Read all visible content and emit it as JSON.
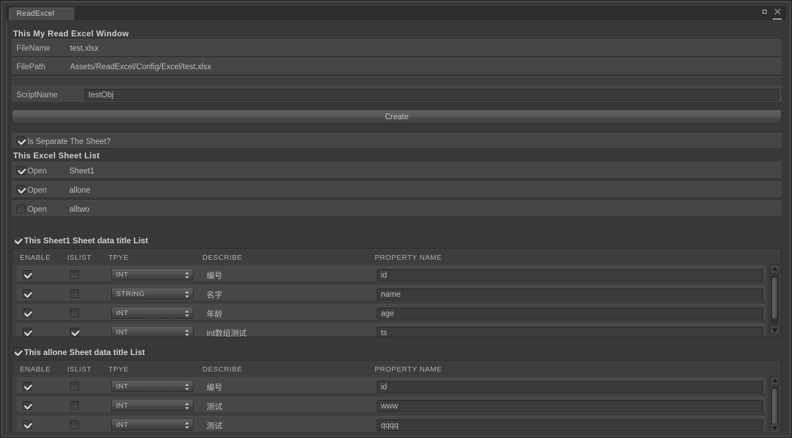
{
  "window": {
    "tab_label": "ReadExcel",
    "header_title": "This My  Read Excel Window",
    "maximize_icon": "maximize-icon",
    "close_icon": "close-icon",
    "menu_icon": "hamburger-menu-icon",
    "menu_arrow_icon": "chevron-down-icon"
  },
  "fields": {
    "filename_label": "FileName",
    "filename_value": "test.xlsx",
    "filepath_label": "FilePath",
    "filepath_value": "Assets/ReadExcel/Config/Excel/test.xlsx",
    "scriptname_label": "ScriptName",
    "scriptname_value": "testObj",
    "scriptname_placeholder": "testObj"
  },
  "create_button": {
    "label": "Create"
  },
  "separate": {
    "label": "Is Separate The Sheet?",
    "checked": true
  },
  "sheet_list": {
    "title": "This  Excel Sheet List",
    "items": [
      {
        "toggle_label": "Open",
        "name": "Sheet1",
        "checked": true
      },
      {
        "toggle_label": "Open",
        "name": "allone",
        "checked": true
      },
      {
        "toggle_label": "Open",
        "name": "alltwo",
        "checked": false
      }
    ]
  },
  "tables": [
    {
      "title": "This Sheet1 Sheet data title List",
      "checked": true,
      "columns": [
        "ENABLE",
        "ISLIST",
        "TPYE",
        "DESCRIBE",
        "PROPERTY NAME"
      ],
      "rows": [
        {
          "enable": true,
          "islist": false,
          "type": "INT",
          "describe": "编号",
          "property": "id"
        },
        {
          "enable": true,
          "islist": false,
          "type": "STRING",
          "describe": "名字",
          "property": "name"
        },
        {
          "enable": true,
          "islist": false,
          "type": "INT",
          "describe": "年龄",
          "property": "age"
        },
        {
          "enable": true,
          "islist": true,
          "type": "INT",
          "describe": "int数组测试",
          "property": "ts"
        }
      ],
      "scrollbar": {
        "up_arrow_icon": "triangle-up-icon",
        "down_arrow_icon": "triangle-down-icon"
      }
    },
    {
      "title": "This allone Sheet data title List",
      "checked": true,
      "columns": [
        "ENABLE",
        "ISLIST",
        "TPYE",
        "DESCRIBE",
        "PROPERTY NAME"
      ],
      "rows": [
        {
          "enable": true,
          "islist": false,
          "type": "INT",
          "describe": "编号",
          "property": "id"
        },
        {
          "enable": true,
          "islist": false,
          "type": "INT",
          "describe": "测试",
          "property": "www"
        },
        {
          "enable": true,
          "islist": false,
          "type": "INT",
          "describe": "测试",
          "property": "qqqq"
        }
      ],
      "scrollbar": {
        "up_arrow_icon": "triangle-up-icon",
        "down_arrow_icon": "triangle-down-icon"
      }
    }
  ],
  "colors": {
    "window_bg": "#383838",
    "row_bg": "#474747",
    "band_bg": "#454545",
    "text": "#b8b8b8",
    "header_text": "#cfcfcf"
  }
}
